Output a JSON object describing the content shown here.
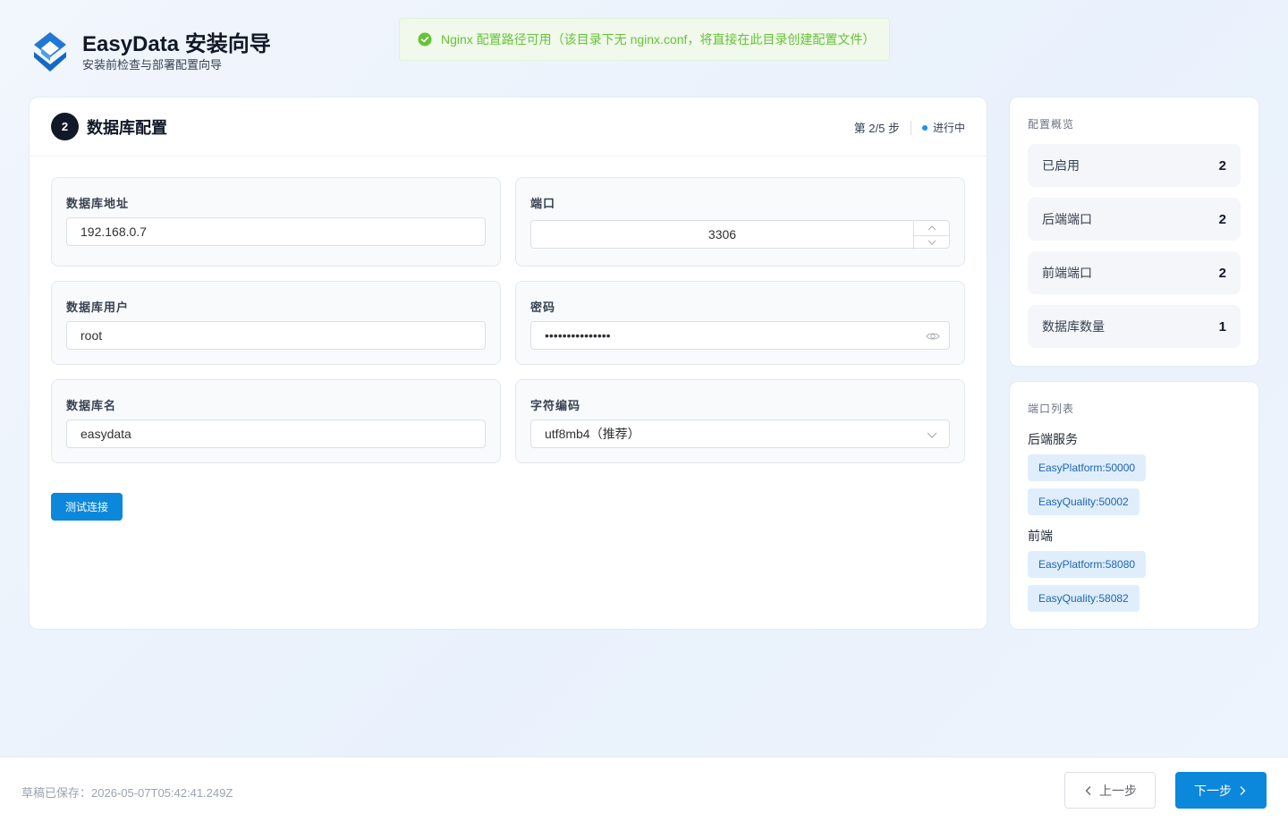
{
  "app": {
    "title": "EasyData 安装向导",
    "subtitle": "安装前检查与部署配置向导"
  },
  "toast": {
    "message": "Nginx 配置路径可用（该目录下无 nginx.conf，将直接在此目录创建配置文件）",
    "type": "success",
    "color": "#67c23a"
  },
  "step": {
    "number": "2",
    "title": "数据库配置",
    "progress": "第 2/5 步",
    "status": "进行中"
  },
  "form": {
    "host": {
      "label": "数据库地址",
      "value": "192.168.0.7"
    },
    "port": {
      "label": "端口",
      "value": "3306"
    },
    "user": {
      "label": "数据库用户",
      "value": "root"
    },
    "password": {
      "label": "密码",
      "value": "•••••••••••••••"
    },
    "dbname": {
      "label": "数据库名",
      "value": "easydata"
    },
    "charset": {
      "label": "字符编码",
      "value": "utf8mb4（推荐）"
    },
    "test_button": "测试连接"
  },
  "overview": {
    "title": "配置概览",
    "stats": [
      {
        "label": "已启用",
        "value": "2"
      },
      {
        "label": "后端端口",
        "value": "2"
      },
      {
        "label": "前端端口",
        "value": "2"
      },
      {
        "label": "数据库数量",
        "value": "1"
      }
    ]
  },
  "ports": {
    "title": "端口列表",
    "backend_label": "后端服务",
    "backend": [
      "EasyPlatform:50000",
      "EasyQuality:50002"
    ],
    "frontend_label": "前端",
    "frontend": [
      "EasyPlatform:58080",
      "EasyQuality:58082"
    ]
  },
  "footer": {
    "draft": "草稿已保存：2026-05-07T05:42:41.249Z",
    "prev": "上一步",
    "next": "下一步"
  },
  "colors": {
    "primary": "#0b87dc",
    "tag_bg": "#e0eefc",
    "tag_text": "#1c64b6"
  }
}
